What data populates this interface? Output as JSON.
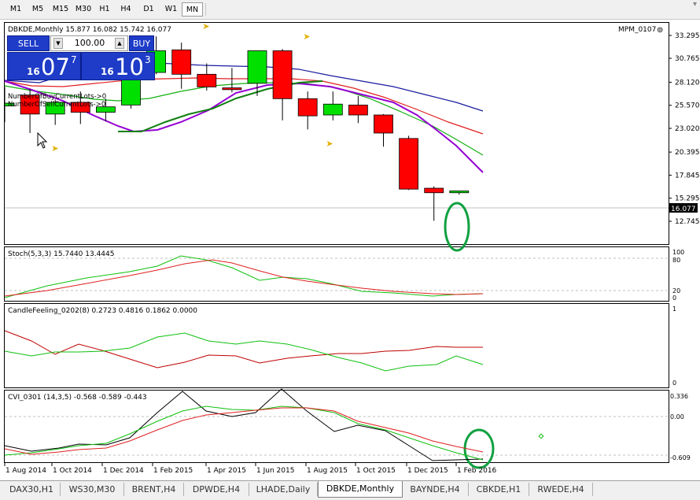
{
  "timeframes": [
    "M1",
    "M5",
    "M15",
    "M30",
    "H1",
    "H4",
    "D1",
    "W1",
    "MN"
  ],
  "active_timeframe": "MN",
  "chart_header": "DBKDE,Monthly  15.877 16.082 15.742 16.077",
  "indicator_name": "MPM_0107",
  "trade_panel": {
    "sell_label": "SELL",
    "buy_label": "BUY",
    "lot_value": "100.00",
    "sell_small": "16",
    "sell_big": "07",
    "sell_sup": "7",
    "buy_small": "16",
    "buy_big": "10",
    "buy_sup": "3"
  },
  "overlay_lines": [
    "NumberOfBuyCurrentLots->0",
    "NumberOfSellCurrentLots->0"
  ],
  "price_axis": [
    "33.295",
    "30.765",
    "28.120",
    "25.570",
    "23.020",
    "20.395",
    "17.845",
    "15.295",
    "12.745"
  ],
  "last_price": "16.077",
  "stoch": {
    "label": "Stoch(5,3,3) 15.7440 13.4445",
    "levels": [
      "100",
      "80",
      "20",
      "0"
    ]
  },
  "candlefeeling": {
    "label": "CandleFeeling_0202(8) 0.2723 0.4816 0.1862 0.0000",
    "levels": [
      "1",
      "0"
    ]
  },
  "cvi": {
    "label": "CVI_0301 (14,3,5) -0.568 -0.589 -0.443",
    "levels": [
      "0.336",
      "0.00",
      "-0.609"
    ]
  },
  "date_axis": [
    "1 Aug 2014",
    "1 Oct 2014",
    "1 Dec 2014",
    "1 Feb 2015",
    "1 Apr 2015",
    "1 Jun 2015",
    "1 Aug 2015",
    "1 Oct 2015",
    "1 Dec 2015",
    "1 Feb 2016"
  ],
  "tabs": [
    "DAX30,H1",
    "WS30,M30",
    "BRENT,H4",
    "DPWDE,H4",
    "LHADE,Daily",
    "DBKDE,Monthly",
    "BAYNDE,H4",
    "CBKDE,H1",
    "RWEDE,H4"
  ],
  "active_tab": "DBKDE,Monthly",
  "colors": {
    "bull": "#00e000",
    "bear": "#ff0000",
    "panel_blue": "#1e3cc8",
    "ellipse": "#10a040",
    "ma_purple": "#9400d3",
    "ma_blue": "#1a1aa0"
  },
  "candles": [
    {
      "o": 25.5,
      "h": 27.6,
      "l": 23.7,
      "c": 25.8
    },
    {
      "o": 26.7,
      "h": 27.4,
      "l": 22.5,
      "c": 24.6
    },
    {
      "o": 24.6,
      "h": 26.2,
      "l": 23.4,
      "c": 25.9
    },
    {
      "o": 25.9,
      "h": 27.1,
      "l": 23.5,
      "c": 24.8
    },
    {
      "o": 24.8,
      "h": 26.3,
      "l": 23.8,
      "c": 25.4
    },
    {
      "o": 25.6,
      "h": 29.8,
      "l": 25.2,
      "c": 29.0
    },
    {
      "o": 29.2,
      "h": 33.2,
      "l": 29.0,
      "c": 31.6
    },
    {
      "o": 31.7,
      "h": 32.5,
      "l": 27.4,
      "c": 29.0
    },
    {
      "o": 29.0,
      "h": 30.2,
      "l": 27.2,
      "c": 27.6
    },
    {
      "o": 27.5,
      "h": 29.7,
      "l": 27.0,
      "c": 27.3
    },
    {
      "o": 28.0,
      "h": 31.6,
      "l": 26.6,
      "c": 31.6
    },
    {
      "o": 31.6,
      "h": 31.8,
      "l": 23.9,
      "c": 26.3
    },
    {
      "o": 26.3,
      "h": 27.1,
      "l": 22.9,
      "c": 24.4
    },
    {
      "o": 24.5,
      "h": 27.1,
      "l": 23.9,
      "c": 25.7
    },
    {
      "o": 25.6,
      "h": 26.6,
      "l": 23.6,
      "c": 24.5
    },
    {
      "o": 24.5,
      "h": 24.6,
      "l": 21.0,
      "c": 22.5
    },
    {
      "o": 21.9,
      "h": 22.2,
      "l": 16.2,
      "c": 16.3
    },
    {
      "o": 16.4,
      "h": 16.6,
      "l": 12.8,
      "c": 15.9
    },
    {
      "o": 15.9,
      "h": 16.1,
      "l": 15.7,
      "c": 16.1
    }
  ]
}
